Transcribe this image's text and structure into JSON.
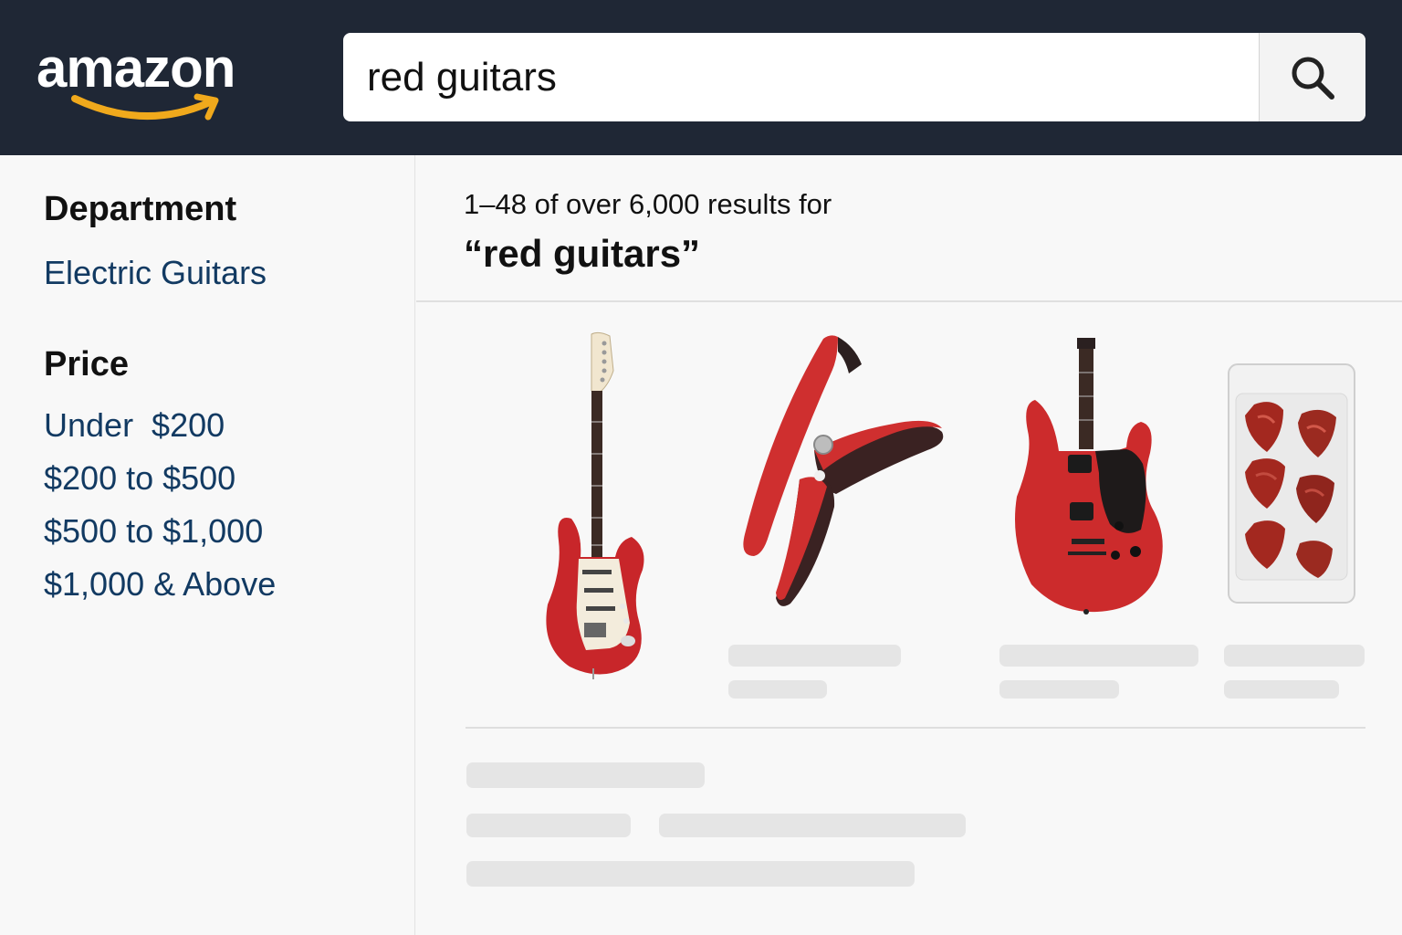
{
  "header": {
    "logo_text": "amazon",
    "search": {
      "value": "red guitars",
      "placeholder": ""
    },
    "search_icon": "search-icon"
  },
  "sidebar": {
    "department_heading": "Department",
    "department_link": "Electric Guitars",
    "price_heading": "Price",
    "price_links": [
      "Under  $200",
      "$200 to $500",
      "$500 to $1,000",
      "$1,000 & Above"
    ]
  },
  "results": {
    "count_text": "1–48 of over 6,000 results for",
    "query_text": "“red guitars”",
    "products": [
      {
        "kind": "red-stratocaster-guitar"
      },
      {
        "kind": "red-guitar-capo"
      },
      {
        "kind": "red-electric-guitar-black-pickguard"
      },
      {
        "kind": "red-guitar-picks-pack"
      }
    ]
  },
  "colors": {
    "header_bg": "#1f2735",
    "link": "#123a62",
    "logo_smile": "#f0a91c",
    "guitar_red": "#c8262a",
    "skeleton": "#e5e5e5"
  }
}
